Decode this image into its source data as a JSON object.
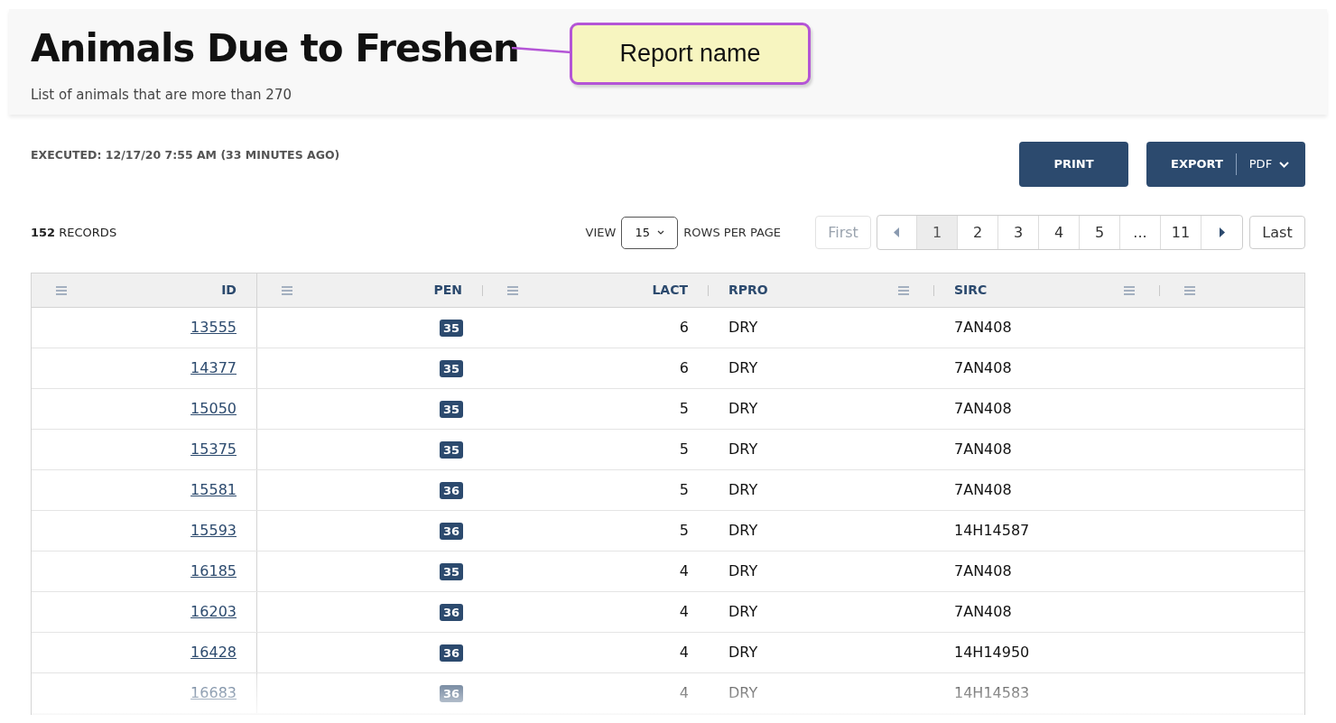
{
  "header": {
    "title": "Animals Due to Freshen",
    "subtitle": "List of animals that are more than 270"
  },
  "callout": {
    "text": "Report name"
  },
  "executed": "EXECUTED: 12/17/20 7:55 AM (33 MINUTES AGO)",
  "actions": {
    "print": "PRINT",
    "export": "EXPORT",
    "format": "PDF"
  },
  "records": {
    "count": "152",
    "label": "RECORDS"
  },
  "view": {
    "label": "VIEW",
    "value": "15",
    "suffix": "ROWS PER PAGE"
  },
  "pagination": {
    "first": {
      "label": "First",
      "disabled": true
    },
    "last": {
      "label": "Last",
      "disabled": false
    },
    "pages": [
      {
        "label": "1",
        "selected": true
      },
      {
        "label": "2",
        "selected": false
      },
      {
        "label": "3",
        "selected": false
      },
      {
        "label": "4",
        "selected": false
      },
      {
        "label": "5",
        "selected": false
      },
      {
        "label": "...",
        "selected": false
      },
      {
        "label": "11",
        "selected": false
      }
    ]
  },
  "table": {
    "columns": [
      "ID",
      "PEN",
      "LACT",
      "RPRO",
      "SIRC"
    ],
    "rows": [
      {
        "id": "13555",
        "pen": "35",
        "lact": "6",
        "rpro": "DRY",
        "sirc": "7AN408"
      },
      {
        "id": "14377",
        "pen": "35",
        "lact": "6",
        "rpro": "DRY",
        "sirc": "7AN408"
      },
      {
        "id": "15050",
        "pen": "35",
        "lact": "5",
        "rpro": "DRY",
        "sirc": "7AN408"
      },
      {
        "id": "15375",
        "pen": "35",
        "lact": "5",
        "rpro": "DRY",
        "sirc": "7AN408"
      },
      {
        "id": "15581",
        "pen": "36",
        "lact": "5",
        "rpro": "DRY",
        "sirc": "7AN408"
      },
      {
        "id": "15593",
        "pen": "36",
        "lact": "5",
        "rpro": "DRY",
        "sirc": "14H14587"
      },
      {
        "id": "16185",
        "pen": "35",
        "lact": "4",
        "rpro": "DRY",
        "sirc": "7AN408"
      },
      {
        "id": "16203",
        "pen": "36",
        "lact": "4",
        "rpro": "DRY",
        "sirc": "7AN408"
      },
      {
        "id": "16428",
        "pen": "36",
        "lact": "4",
        "rpro": "DRY",
        "sirc": "14H14950"
      },
      {
        "id": "16683",
        "pen": "36",
        "lact": "4",
        "rpro": "DRY",
        "sirc": "14H14583"
      }
    ]
  }
}
